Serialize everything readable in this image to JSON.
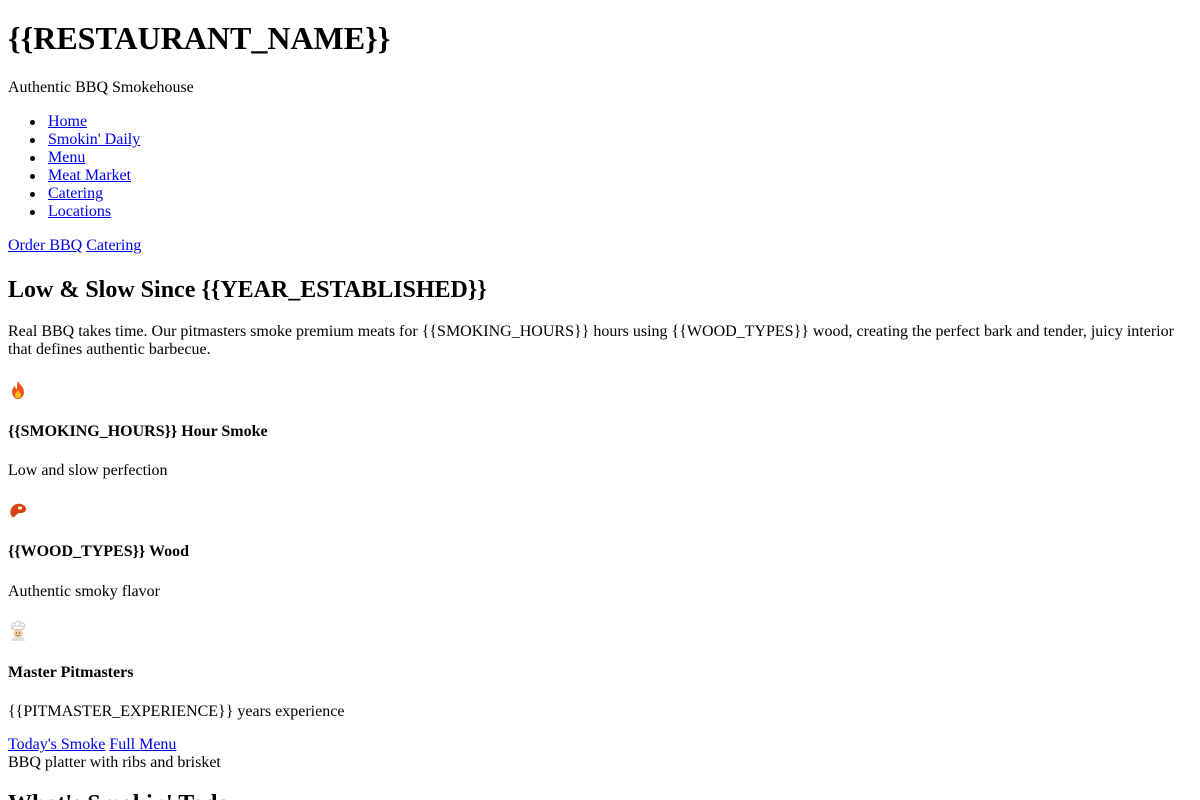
{
  "header": {
    "restaurant_name": "{{RESTAURANT_NAME}}",
    "tagline": "Authentic BBQ Smokehouse"
  },
  "nav": {
    "items": [
      {
        "label": "Home"
      },
      {
        "label": "Smokin' Daily"
      },
      {
        "label": "Menu"
      },
      {
        "label": "Meat Market"
      },
      {
        "label": "Catering"
      },
      {
        "label": "Locations"
      }
    ]
  },
  "actions": {
    "order_label": "Order BBQ",
    "catering_label": "Catering"
  },
  "hero": {
    "title": "Low & Slow Since {{YEAR_ESTABLISHED}}",
    "text": "Real BBQ takes time. Our pitmasters smoke premium meats for {{SMOKING_HOURS}} hours using {{WOOD_TYPES}} wood, creating the perfect bark and tender, juicy interior that defines authentic barbecue."
  },
  "features": [
    {
      "icon": "fire-icon",
      "title": "{{SMOKING_HOURS}} Hour Smoke",
      "desc": "Low and slow perfection"
    },
    {
      "icon": "steak-icon",
      "title": "{{WOOD_TYPES}} Wood",
      "desc": "Authentic smoky flavor"
    },
    {
      "icon": "chef-icon",
      "title": "Master Pitmasters",
      "desc": "{{PITMASTER_EXPERIENCE}} years experience"
    }
  ],
  "cta": {
    "today_label": "Today's Smoke",
    "menu_label": "Full Menu"
  },
  "hero_image": {
    "alt": "BBQ platter with ribs and brisket"
  },
  "next_section": {
    "heading": "What's Smokin' Today"
  },
  "colors": {
    "link": "#0000ee",
    "text": "#000000",
    "background": "#ffffff",
    "fire_icon": "#f4511e",
    "steak_icon": "#d84315",
    "chef_icon": "#f2c9a0"
  }
}
